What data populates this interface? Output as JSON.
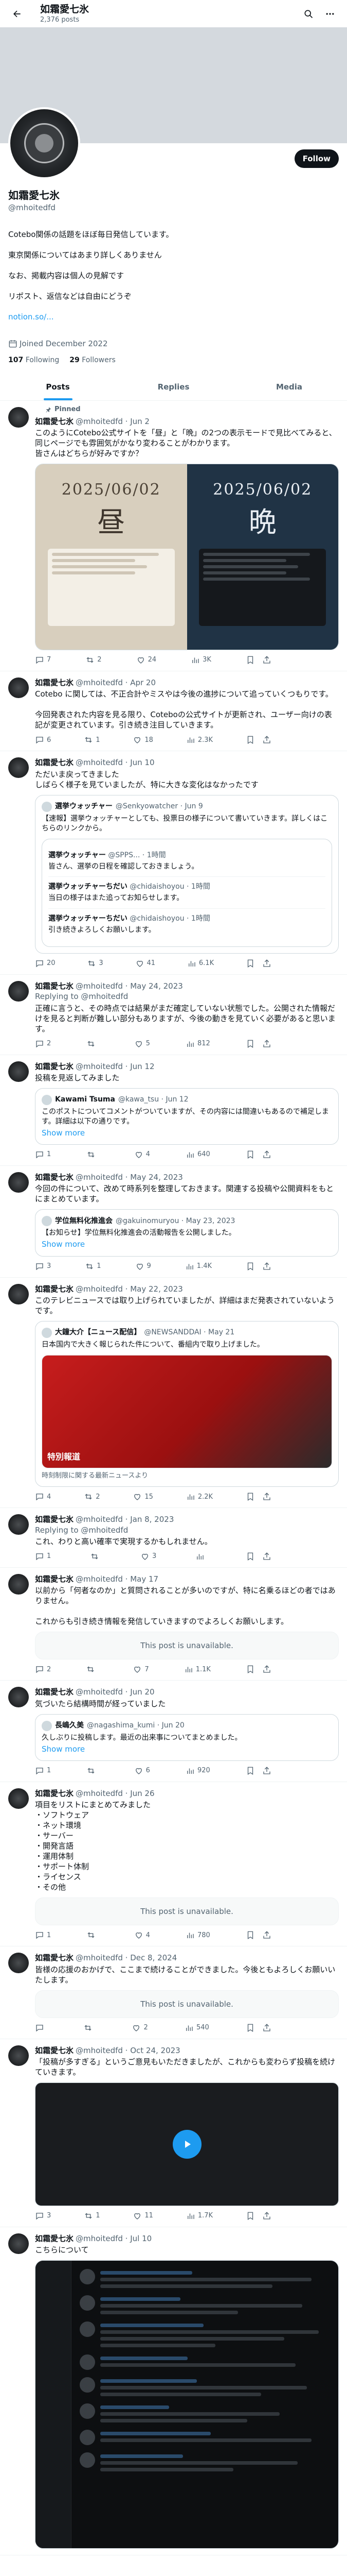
{
  "topbar": {
    "name": "如霜愛七氷",
    "posts_count": "2,376 posts"
  },
  "colors": {
    "accent": "#1d9bf0",
    "text": "#0f1419",
    "muted": "#536471"
  },
  "profile": {
    "name": "如霜愛七氷",
    "handle": "@mhoitedfd",
    "follow_label": "Follow",
    "bio": "Cotebo関係の話題をほぼ毎日発信しています。",
    "bio2": "東京関係についてはあまり詳しくありません",
    "bio3": "なお、掲載内容は個人の見解です",
    "bio4": "リポスト、返信などは自由にどうぞ",
    "bio_link": "notion.so/...",
    "joined": "Joined December 2022",
    "following_count": "107",
    "following_label": "Following",
    "followers_count": "29",
    "followers_label": "Followers"
  },
  "tabs": [
    {
      "label": "Posts",
      "active": true
    },
    {
      "label": "Replies",
      "active": false
    },
    {
      "label": "Media",
      "active": false
    }
  ],
  "tweets": [
    {
      "pinned": "Pinned",
      "name": "如霜愛七氷",
      "handle": "@mhoitedfd · Jun 2",
      "text": "このようにCotebo公式サイトを「昼」と「晩」の2つの表示モードで見比べてみると、同じページでも雰囲気がかなり変わることがわかります。\n皆さんはどちらが好みですか？",
      "media": {
        "date_day": "2025/06/02",
        "word_day": "昼",
        "date_night": "2025/06/02",
        "word_night": "晩"
      },
      "actions": {
        "reply": "7",
        "retweet": "2",
        "like": "24",
        "views": "3K"
      }
    },
    {
      "name": "如霜愛七氷",
      "handle": "@mhoitedfd · Apr 20",
      "text": "Cotebo に関しては、不正合計やミスやは今後の進捗について追っていくつもりです。\n\n今回発表された内容を見る限り、Coteboの公式サイトが更新され、ユーザー向けの表記が変更されています。引き続き注目していきます。",
      "actions": {
        "reply": "6",
        "retweet": "1",
        "like": "18",
        "views": "2.3K"
      }
    },
    {
      "name": "如霜愛七氷",
      "handle": "@mhoitedfd · Jun 10",
      "text": "ただいま戻ってきました\nしばらく様子を見ていましたが、特に大きな変化はなかったです",
      "quote": {
        "name": "選挙ウォッチャー",
        "handle": "@Senkyowatcher · Jun 9",
        "text": "【速報】選挙ウォッチャーとしても、投票日の様子について書いていきます。詳しくはこちらのリンクから。"
      },
      "nested": [
        {
          "name": "選挙ウォッチャー",
          "handle": "@SPPS... · 1時間",
          "text": "皆さん、選挙の日程を確認しておきましょう。"
        },
        {
          "name": "選挙ウォッチャーちだい",
          "handle": "@chidaishoyou · 1時間",
          "text": "当日の様子はまた追ってお知らせします。"
        },
        {
          "name": "選挙ウォッチャーちだい",
          "handle": "@chidaishoyou · 1時間",
          "text": "引き続きよろしくお願いします。"
        }
      ],
      "actions": {
        "reply": "20",
        "retweet": "3",
        "like": "41",
        "views": "6.1K"
      }
    },
    {
      "name": "如霜愛七氷",
      "handle": "@mhoitedfd · May 24, 2023",
      "replying": "Replying to @mhoitedfd",
      "text": "正確に言うと、その時点では結果がまだ確定していない状態でした。公開された情報だけを見ると判断が難しい部分もありますが、今後の動きを見ていく必要があると思います。",
      "actions": {
        "reply": "2",
        "retweet": "",
        "like": "5",
        "views": "812"
      }
    },
    {
      "name": "如霜愛七氷",
      "handle": "@mhoitedfd · Jun 12",
      "text": "投稿を見返してみました",
      "quote": {
        "name": "Kawami Tsuma",
        "handle": "@kawa_tsu · Jun 12",
        "text": "このポストについてコメントがついていますが、その内容には間違いもあるので補足します。詳細は以下の通りです。",
        "show_more": "Show more"
      },
      "actions": {
        "reply": "1",
        "retweet": "",
        "like": "4",
        "views": "640"
      }
    },
    {
      "name": "如霜愛七氷",
      "handle": "@mhoitedfd · May 24, 2023",
      "text": "今回の件について、改めて時系列を整理しておきます。関連する投稿や公開資料をもとにまとめています。",
      "quote": {
        "name": "学位無料化推進会",
        "handle": "@gakuinomuryou · May 23, 2023",
        "text": "【お知らせ】学位無料化推進会の活動報告を公開しました。",
        "show_more": "Show more"
      },
      "actions": {
        "reply": "3",
        "retweet": "1",
        "like": "9",
        "views": "1.4K"
      }
    },
    {
      "name": "如霜愛七氷",
      "handle": "@mhoitedfd · May 22, 2023",
      "text": "このテレビニュースでは取り上げられていましたが、詳細はまだ発表されていないようです。",
      "quote": {
        "name": "大鐘大介【ニュース配信】",
        "handle": "@NEWSANDDAI · May 21",
        "text": "日本国内で大きく報じられた件について、番組内で取り上げました。",
        "news_title": "特別報道",
        "news_caption": "時刻制限に関する最新ニュースより"
      },
      "actions": {
        "reply": "4",
        "retweet": "2",
        "like": "15",
        "views": "2.2K"
      }
    },
    {
      "name": "如霜愛七氷",
      "handle": "@mhoitedfd · Jan 8, 2023",
      "replying": "Replying to @mhoitedfd",
      "text": "これ、わりと高い確率で実現するかもしれません。",
      "actions": {
        "reply": "1",
        "retweet": "",
        "like": "3",
        "views": ""
      }
    },
    {
      "name": "如霜愛七氷",
      "handle": "@mhoitedfd · May 17",
      "text": "以前から「何者なのか」と質問されることが多いのですが、特に名乗るほどの者ではありません。\n\nこれからも引き続き情報を発信していきますのでよろしくお願いします。",
      "unavailable": "This post is unavailable.",
      "actions": {
        "reply": "2",
        "retweet": "",
        "like": "7",
        "views": "1.1K"
      }
    },
    {
      "name": "如霜愛七氷",
      "handle": "@mhoitedfd · Jun 20",
      "text": "気づいたら結構時間が経っていました",
      "quote": {
        "name": "長嶋久美",
        "handle": "@nagashima_kumi · Jun 20",
        "text": "久しぶりに投稿します。最近の出来事についてまとめました。",
        "show_more": "Show more"
      },
      "actions": {
        "reply": "1",
        "retweet": "",
        "like": "6",
        "views": "920"
      }
    },
    {
      "name": "如霜愛七氷",
      "handle": "@mhoitedfd · Jun 26",
      "text": "項目をリストにまとめてみました\n・ソフトウェア\n・ネット環境\n・サーバー\n・開発言語\n・運用体制\n・サポート体制\n・ライセンス\n・その他",
      "unavailable": "This post is unavailable.",
      "actions": {
        "reply": "1",
        "retweet": "",
        "like": "4",
        "views": "780"
      }
    },
    {
      "name": "如霜愛七氷",
      "handle": "@mhoitedfd · Dec 8, 2024",
      "text": "皆様の応援のおかげで、ここまで続けることができました。今後ともよろしくお願いいたします。",
      "unavailable": "This post is unavailable.",
      "actions": {
        "reply": "",
        "retweet": "",
        "like": "2",
        "views": "540"
      }
    },
    {
      "name": "如霜愛七氷",
      "handle": "@mhoitedfd · Oct 24, 2023",
      "text": "「投稿が多すぎる」というご意見もいただきましたが、これからも変わらず投稿を続けていきます。",
      "actions": {
        "reply": "3",
        "retweet": "1",
        "like": "11",
        "views": "1.7K"
      }
    },
    {
      "name": "如霜愛七氷",
      "handle": "@mhoitedfd · Jul 10",
      "text": "こちらについて",
      "actions": {
        "reply": "1",
        "retweet": "",
        "like": "5",
        "views": "860"
      }
    }
  ]
}
